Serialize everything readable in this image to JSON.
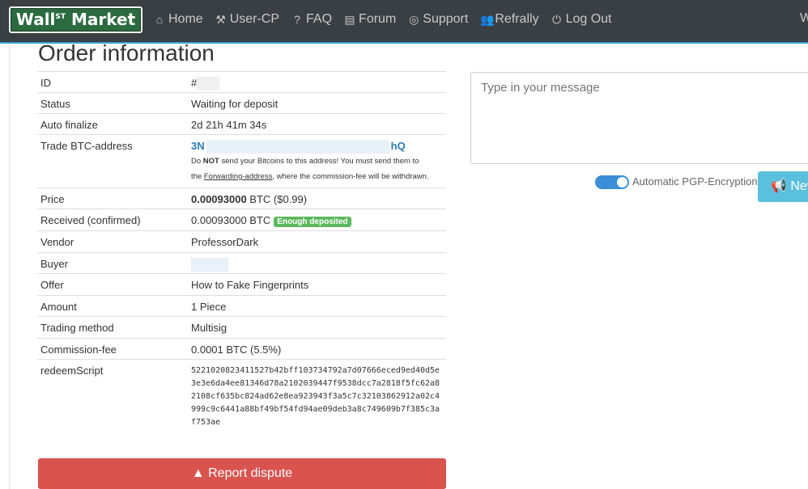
{
  "navbar": {
    "brand_main": "Wall",
    "brand_sup": "ST",
    "brand_tail": " Market",
    "items": [
      {
        "icon": "home-icon",
        "glyph": "⌂",
        "label": "Home"
      },
      {
        "icon": "wrench-icon",
        "glyph": "⚒",
        "label": "User-CP"
      },
      {
        "icon": "question-icon",
        "glyph": "?",
        "label": "FAQ"
      },
      {
        "icon": "forum-icon",
        "glyph": "▤",
        "label": "Forum"
      },
      {
        "icon": "support-icon",
        "glyph": "◎",
        "label": "Support"
      },
      {
        "icon": "users-icon",
        "glyph": "👥",
        "label": "Refrally"
      },
      {
        "icon": "logout-icon",
        "glyph": "⏻",
        "label": "Log Out"
      }
    ],
    "cut_text": "W"
  },
  "page_title": "Order information",
  "order": {
    "id_label": "ID",
    "id_value": "#",
    "status_label": "Status",
    "status_value": "Waiting for deposit",
    "autofinalize_label": "Auto finalize",
    "autofinalize_value": "2d 21h 41m 34s",
    "btc_label": "Trade BTC-address",
    "btc_prefix": "3N",
    "btc_suffix": "hQ",
    "btc_note_1": "Do ",
    "btc_note_not": "NOT",
    "btc_note_2": " send your Bitcoins to this address! You must send them to",
    "btc_note_3": "the ",
    "btc_note_link": "Forwarding-address",
    "btc_note_4": ", where the commission-fee will be withdrawn.",
    "price_label": "Price",
    "price_amount": "0.00093000",
    "price_rest": " BTC ($0.99)",
    "received_label": "Received (confirmed)",
    "received_value": "0.00093000 BTC",
    "received_badge": "Enough deposited",
    "vendor_label": "Vendor",
    "vendor_value": "ProfessorDark",
    "buyer_label": "Buyer",
    "offer_label": "Offer",
    "offer_value": "How to Fake Fingerprints",
    "amount_label": "Amount",
    "amount_value": "1 Piece",
    "trading_label": "Trading method",
    "trading_value": "Multisig",
    "commission_label": "Commission-fee",
    "commission_value": "0.0001 BTC (5.5%)",
    "redeem_label": "redeemScript",
    "redeem_value": "5221020823411527b42bff103734792a7d07666eced9ed40d5e3e3e6da4ee81346d78a2102039447f9538dcc7a2818f5fc62a82108cf635bc824ad62e8ea923943f3a5c7c32103862912a02c4999c9c6441a88bf49bf54fd94ae09deb3a8c749609b7f385c3af753ae"
  },
  "dispute_button": "Report dispute",
  "dispute_icon": "warning-icon",
  "message": {
    "placeholder": "Type in your message",
    "pgp_label": "Automatic PGP-Encryption",
    "pgp_enabled": true,
    "new_button": "New"
  },
  "colors": {
    "navbar": "#3a3f44",
    "brand": "#2b6b3f",
    "accent_line": "#3aa3d8",
    "dispute": "#d9534f",
    "new_button": "#5bc0de",
    "badge": "#5cb85c",
    "link": "#2a7ab8"
  }
}
